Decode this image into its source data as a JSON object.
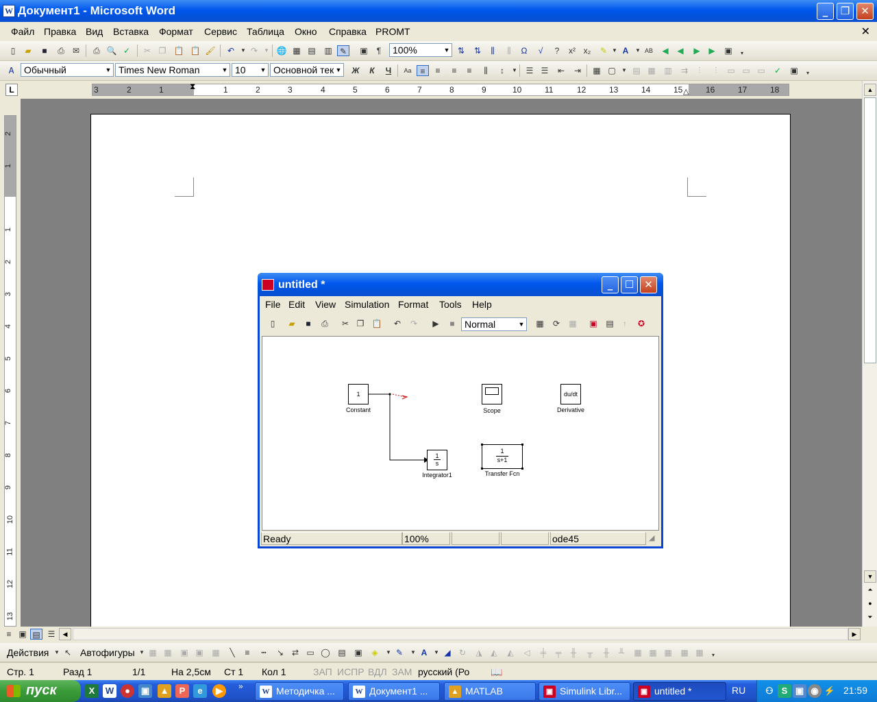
{
  "word": {
    "title": "Документ1 - Microsoft Word",
    "menu": [
      "Файл",
      "Правка",
      "Вид",
      "Вставка",
      "Формат",
      "Сервис",
      "Таблица",
      "Окно",
      "Справка",
      "PROMT"
    ],
    "zoom": "100%",
    "style": "Обычный",
    "font": "Times New Roman",
    "size": "10",
    "text_style": "Основной тек",
    "bold": "Ж",
    "italic": "К",
    "underline": "Ч",
    "ruler_left": [
      "3",
      "2",
      "1"
    ],
    "ruler_right": [
      "1",
      "2",
      "3",
      "4",
      "5",
      "6",
      "7",
      "8",
      "9",
      "10",
      "11",
      "12",
      "13",
      "14",
      "15",
      "16",
      "17",
      "18"
    ],
    "vruler": [
      "2",
      "1",
      "1",
      "2",
      "3",
      "4",
      "5",
      "6",
      "7",
      "8",
      "9",
      "10",
      "11",
      "12",
      "13"
    ]
  },
  "drawing": {
    "actions": "Действия",
    "autoshapes": "Автофигуры"
  },
  "status": {
    "page": "Стр. 1",
    "section": "Разд 1",
    "pages": "1/1",
    "at": "На 2,5см",
    "line": "Ст 1",
    "col": "Кол 1",
    "rec": "ЗАП",
    "trk": "ИСПР",
    "ext": "ВДЛ",
    "ovr": "ЗАМ",
    "lang": "русский (Ро"
  },
  "simulink": {
    "title": "untitled *",
    "menu": [
      "File",
      "Edit",
      "View",
      "Simulation",
      "Format",
      "Tools",
      "Help"
    ],
    "mode": "Normal",
    "status_ready": "Ready",
    "status_zoom": "100%",
    "status_solver": "ode45",
    "blocks": {
      "constant_value": "1",
      "constant_label": "Constant",
      "scope_label": "Scope",
      "derivative_text": "du/dt",
      "derivative_label": "Derivative",
      "integrator_num": "1",
      "integrator_den": "s",
      "integrator_label": "Integrator1",
      "tf_num": "1",
      "tf_den": "s+1",
      "tf_label": "Transfer Fcn"
    }
  },
  "taskbar": {
    "start": "пуск",
    "tasks": [
      "Методичка ...",
      "Документ1 ...",
      "MATLAB",
      "Simulink Libr...",
      "untitled *"
    ],
    "lang": "RU",
    "clock": "21:59"
  }
}
